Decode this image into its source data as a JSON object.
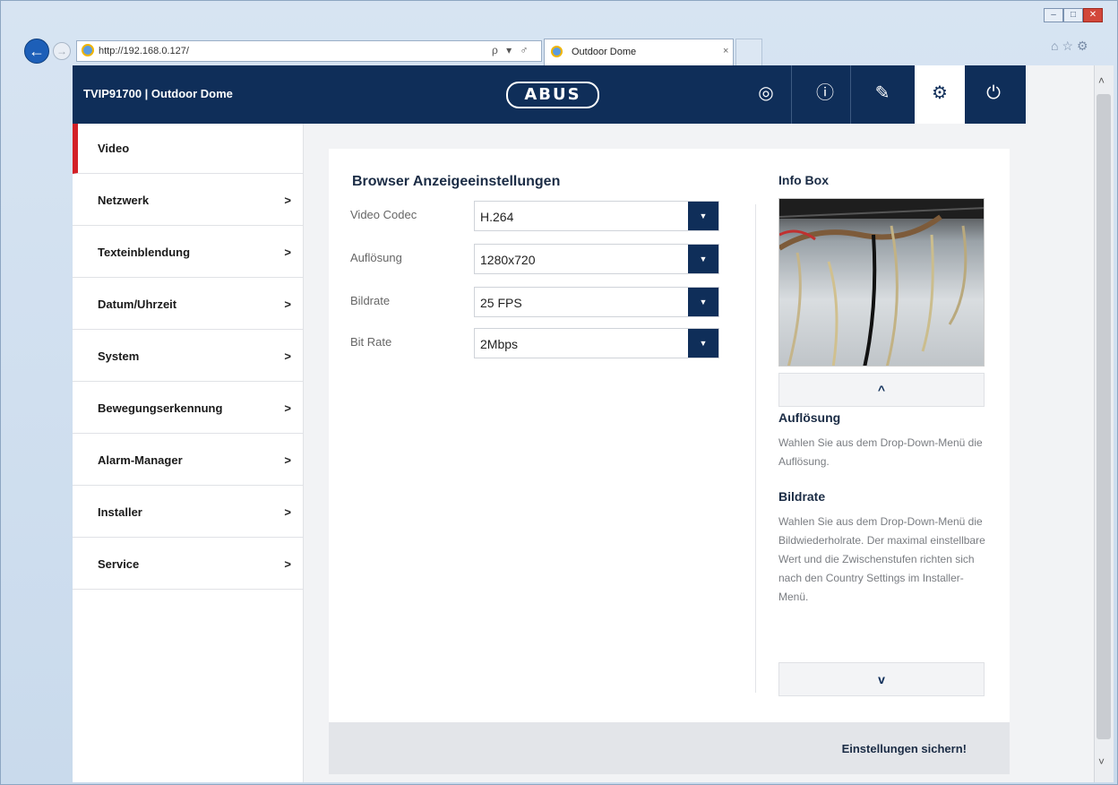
{
  "browser": {
    "url": "http://192.168.0.127/",
    "tab_title": "Outdoor Dome",
    "tab_close": "×",
    "address_tools": "ρ ▾ ♂"
  },
  "header": {
    "device_title": "TVIP91700 | Outdoor Dome",
    "logo": "ABUS",
    "buttons": [
      {
        "name": "live-view",
        "glyph": "◎"
      },
      {
        "name": "info",
        "glyph": "ⓘ"
      },
      {
        "name": "wizard",
        "glyph": "✎"
      },
      {
        "name": "settings",
        "glyph": "⚙"
      },
      {
        "name": "power",
        "glyph": "⏻"
      }
    ]
  },
  "sidebar": {
    "items": [
      {
        "label": "Video",
        "chevron": ""
      },
      {
        "label": "Netzwerk",
        "chevron": ">"
      },
      {
        "label": "Texteinblendung",
        "chevron": ">"
      },
      {
        "label": "Datum/Uhrzeit",
        "chevron": ">"
      },
      {
        "label": "System",
        "chevron": ">"
      },
      {
        "label": "Bewegungserkennung",
        "chevron": ">"
      },
      {
        "label": "Alarm-Manager",
        "chevron": ">"
      },
      {
        "label": "Installer",
        "chevron": ">"
      },
      {
        "label": "Service",
        "chevron": ">"
      }
    ]
  },
  "main": {
    "title": "Browser Anzeigeeinstellungen",
    "fields": [
      {
        "label": "Video Codec",
        "value": "H.264"
      },
      {
        "label": "Auflösung",
        "value": "1280x720"
      },
      {
        "label": "Bildrate",
        "value": "25 FPS"
      },
      {
        "label": "Bit Rate",
        "value": "2Mbps"
      }
    ],
    "save_label": "Einstellungen sichern!"
  },
  "info": {
    "title": "Info Box",
    "up": "^",
    "down": "v",
    "sections": [
      {
        "heading": "Auflösung",
        "text": "Wahlen Sie aus dem Drop-Down-Menü die Auflösung."
      },
      {
        "heading": "Bildrate",
        "text": "Wahlen Sie aus dem Drop-Down-Menü die Bildwiederholrate. Der maximal einstellbare Wert und die Zwischenstufen richten sich nach den Country Settings im Installer-Menü."
      }
    ]
  },
  "colors": {
    "brand": "#0f2e59",
    "active_marker": "#d32027"
  }
}
